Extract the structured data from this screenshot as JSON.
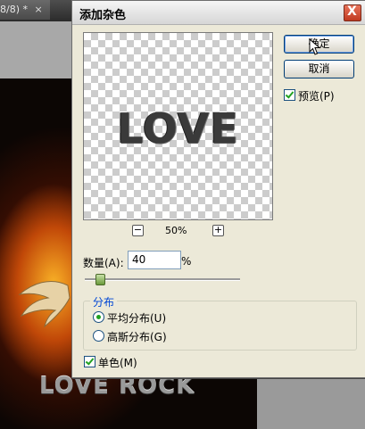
{
  "document": {
    "tab_title": "8/8) *",
    "tab_close": "×",
    "canvas_text": "LOVE ROCK"
  },
  "dialog": {
    "title": "添加杂色",
    "close_glyph": "X",
    "preview_text": "LOVE",
    "zoom_out": "−",
    "zoom_in": "+",
    "zoom_level": "50%",
    "ok_label": "确定",
    "cancel_label": "取消",
    "preview_checkbox_label": "预览(P)",
    "preview_checked": true,
    "amount_label": "数量(A):",
    "amount_value": "40",
    "amount_unit": "%",
    "amount_slider_fraction": 0.1,
    "distribution_legend": "分布",
    "uniform_label": "平均分布(U)",
    "uniform_selected": true,
    "gaussian_label": "高斯分布(G)",
    "gaussian_selected": false,
    "monochromatic_label": "单色(M)",
    "monochromatic_checked": true
  },
  "colors": {
    "dialog_bg": "#ece9d8",
    "checkmark": "#21a121",
    "legend_blue": "#0046d5"
  }
}
